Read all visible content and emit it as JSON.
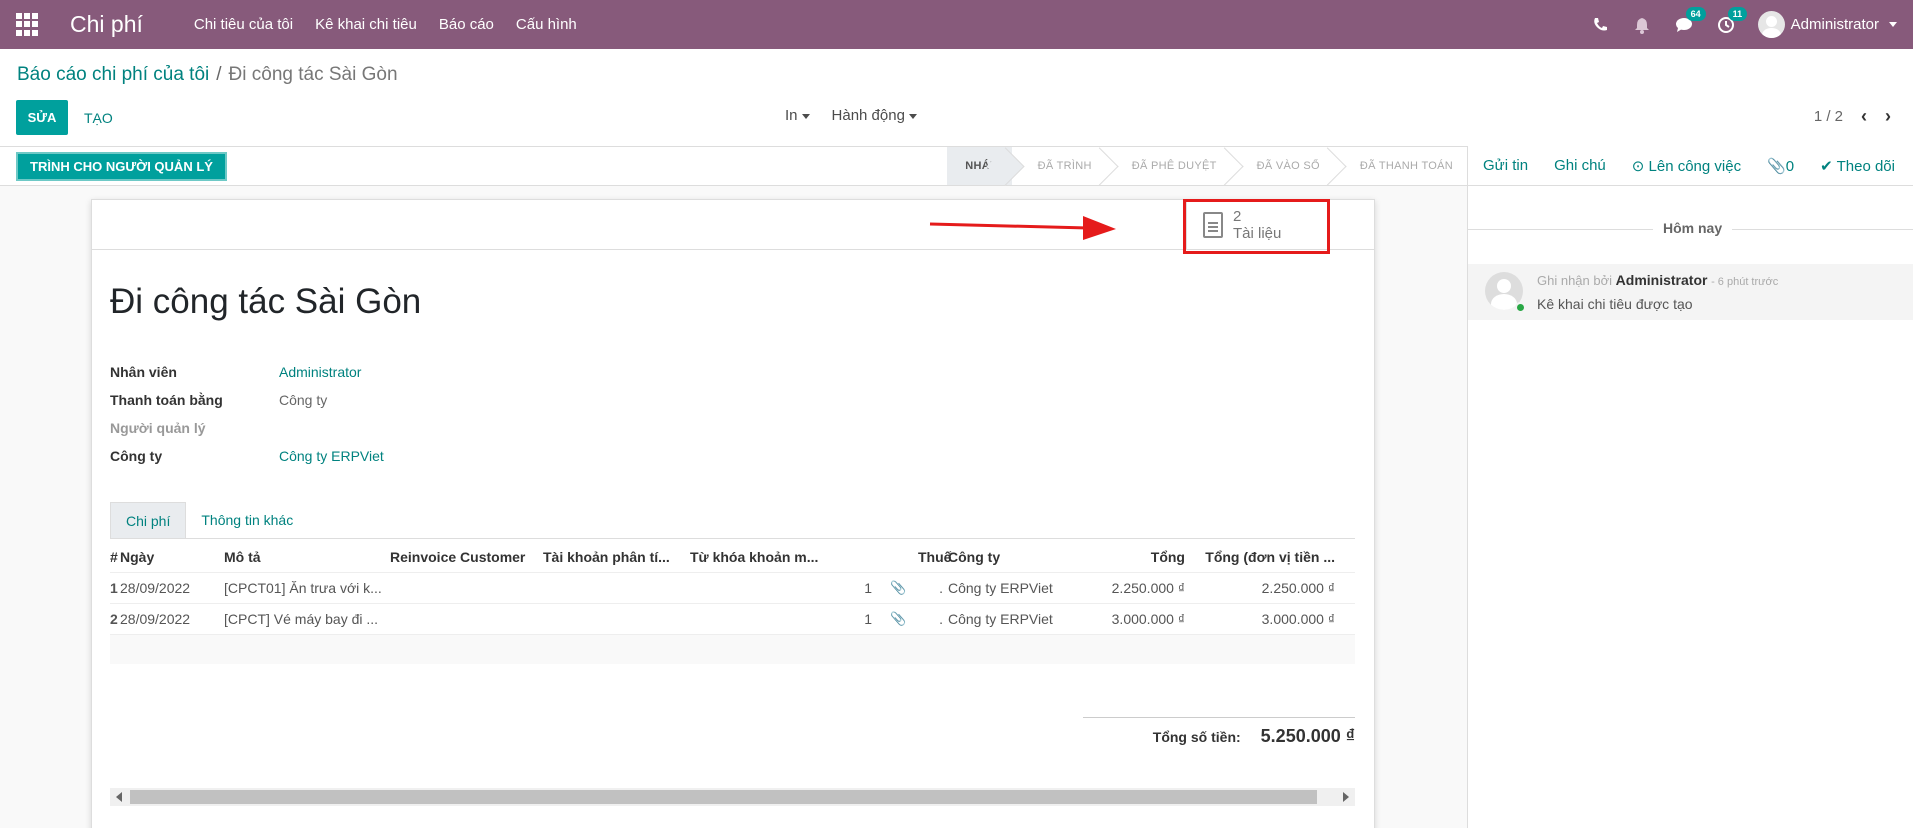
{
  "navbar": {
    "app_title": "Chi phí",
    "menu": [
      "Chi tiêu của tôi",
      "Kê khai chi tiêu",
      "Báo cáo",
      "Cấu hình"
    ],
    "messages_badge": "64",
    "activities_badge": "11",
    "user_name": "Administrator"
  },
  "breadcrumb": {
    "parent": "Báo cáo chi phí của tôi",
    "separator": "/",
    "current": "Đi công tác Sài Gòn"
  },
  "control_panel": {
    "edit_label": "SỬA",
    "create_label": "TẠO",
    "print_label": "In",
    "action_label": "Hành động",
    "pager": "1 / 2"
  },
  "statusbar": {
    "submit_label": "TRÌNH CHO NGƯỜI QUẢN LÝ",
    "stages": [
      "NHÁP",
      "ĐÃ TRÌNH",
      "ĐÃ PHÊ DUYỆT",
      "ĐÃ VÀO SỔ",
      "ĐÃ THANH TOÁN"
    ],
    "current_stage": "NHÁP"
  },
  "stat_button": {
    "count": "2",
    "label": "Tài liệu"
  },
  "record": {
    "title": "Đi công tác Sài Gòn",
    "fields": [
      {
        "label": "Nhân viên",
        "value": "Administrator"
      },
      {
        "label": "Thanh toán bằng",
        "value": "Công ty"
      },
      {
        "label": "Người quản lý",
        "value": ""
      },
      {
        "label": "Công ty",
        "value": "Công ty ERPViet"
      }
    ]
  },
  "tabs": [
    "Chi phí",
    "Thông tin khác"
  ],
  "table": {
    "headers": [
      "#",
      "Ngày",
      "Mô tả",
      "Reinvoice Customer",
      "Tài khoản phân tí...",
      "Từ khóa khoản m...",
      "",
      "",
      "Thuế",
      "Công ty",
      "Tổng",
      "Tổng (đơn vị tiền ..."
    ],
    "rows": [
      {
        "seq": "1",
        "date": "28/09/2022",
        "desc": "[CPCT01] Ăn trưa với k...",
        "qty": "1",
        "att": "📎",
        "tax": ".",
        "company": "Công ty ERPViet",
        "total": "2.250.000 ₫",
        "total_c": "2.250.000 ₫"
      },
      {
        "seq": "2",
        "date": "28/09/2022",
        "desc": "[CPCT] Vé máy bay đi ...",
        "qty": "1",
        "att": "📎",
        "tax": ".",
        "company": "Công ty ERPViet",
        "total": "3.000.000 ₫",
        "total_c": "3.000.000 ₫"
      }
    ]
  },
  "totals": {
    "label": "Tổng số tiền:",
    "value": "5.250.000 ₫"
  },
  "chatter": {
    "send_message": "Gửi tin",
    "log_note": "Ghi chú",
    "schedule_activity": "Lên công việc",
    "attachments_count": "0",
    "follow": "Theo dõi",
    "day_label": "Hôm nay",
    "message": {
      "prefix": "Ghi nhận bởi",
      "author": "Administrator",
      "time": "- 6 phút trước",
      "body": "Kê khai chi tiêu được tạo"
    }
  },
  "colors": {
    "brand": "#875a7b",
    "primary": "#00a09d",
    "highlight": "#e51b1b"
  }
}
